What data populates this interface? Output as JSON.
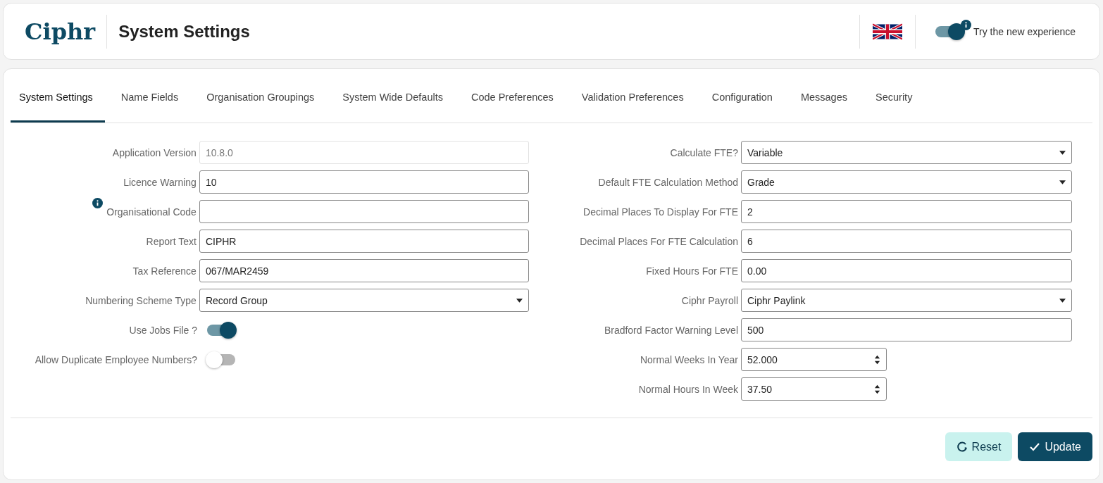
{
  "header": {
    "logo": "Ciphr",
    "title": "System Settings",
    "new_experience": {
      "label": "Try the new experience",
      "on": true,
      "info": true
    }
  },
  "tabs": [
    {
      "label": "System Settings",
      "selected": true
    },
    {
      "label": "Name Fields",
      "selected": false
    },
    {
      "label": "Organisation Groupings",
      "selected": false
    },
    {
      "label": "System Wide Defaults",
      "selected": false
    },
    {
      "label": "Code Preferences",
      "selected": false
    },
    {
      "label": "Validation Preferences",
      "selected": false
    },
    {
      "label": "Configuration",
      "selected": false
    },
    {
      "label": "Messages",
      "selected": false
    },
    {
      "label": "Security",
      "selected": false
    }
  ],
  "left_fields": [
    {
      "label": "Application Version",
      "kind": "text",
      "value": "10.8.0",
      "disabled": true
    },
    {
      "label": "Licence Warning",
      "kind": "text",
      "value": "10",
      "disabled": false
    },
    {
      "label": "Organisational Code",
      "kind": "text",
      "disabled": false,
      "info": true
    },
    {
      "label": "Report Text",
      "kind": "text",
      "value": "CIPHR",
      "disabled": false
    },
    {
      "label": "Tax Reference",
      "kind": "text",
      "value": "067/MAR2459",
      "disabled": false
    },
    {
      "label": "Numbering Scheme Type",
      "kind": "select",
      "value": "Record Group"
    },
    {
      "label": "Use Jobs File ?",
      "kind": "toggle",
      "on": true
    },
    {
      "label": "Allow Duplicate Employee Numbers?",
      "kind": "toggle",
      "on": false
    }
  ],
  "right_fields": [
    {
      "label": "Calculate FTE?",
      "kind": "select",
      "value": "Variable"
    },
    {
      "label": "Default FTE Calculation Method",
      "kind": "select",
      "value": "Grade"
    },
    {
      "label": "Decimal Places To Display For FTE",
      "kind": "text",
      "value": "2",
      "disabled": false
    },
    {
      "label": "Decimal Places For FTE Calculation",
      "kind": "text",
      "value": "6",
      "disabled": false
    },
    {
      "label": "Fixed Hours For FTE",
      "kind": "text",
      "value": "0.00",
      "disabled": false
    },
    {
      "label": "Ciphr Payroll",
      "kind": "select",
      "value": "Ciphr Paylink"
    },
    {
      "label": "Bradford Factor Warning Level",
      "kind": "text",
      "value": "500",
      "disabled": false
    },
    {
      "label": "Normal Weeks In Year",
      "kind": "number",
      "value": "52.000"
    },
    {
      "label": "Normal Hours In Week",
      "kind": "number",
      "value": "37.50"
    }
  ],
  "buttons": [
    {
      "label": "Reset",
      "kind": "reset"
    },
    {
      "label": "Update",
      "kind": "update"
    }
  ]
}
